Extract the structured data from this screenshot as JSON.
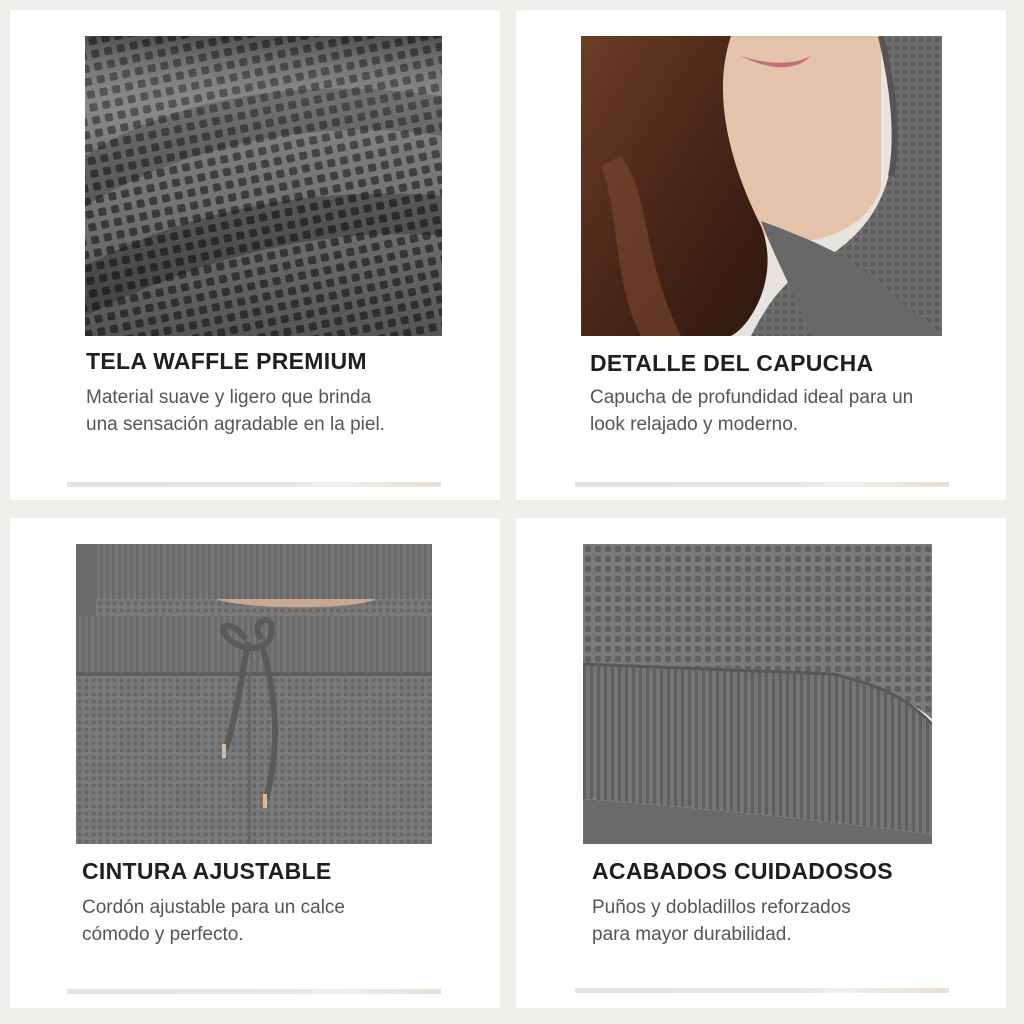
{
  "cards": [
    {
      "title": "TELA WAFFLE PREMIUM",
      "description": "Material suave y ligero que brinda una sensación agradable en la piel."
    },
    {
      "title": "DETALLE DEL CAPUCHA",
      "description": "Capucha de profundidad ideal para un look relajado y moderno."
    },
    {
      "title": "CINTURA AJUSTABLE",
      "description": "Cordón ajustable para un calce cómodo y perfecto."
    },
    {
      "title": "ACABADOS CUIDADOSOS",
      "description": "Puños y dobladillos reforzados para mayor durabilidad."
    }
  ],
  "colors": {
    "page_background": "#f1efec",
    "card_background": "#ffffff",
    "fabric_gray": "#6e6e6e",
    "title_text": "#1f1f1f",
    "body_text": "#555555"
  }
}
